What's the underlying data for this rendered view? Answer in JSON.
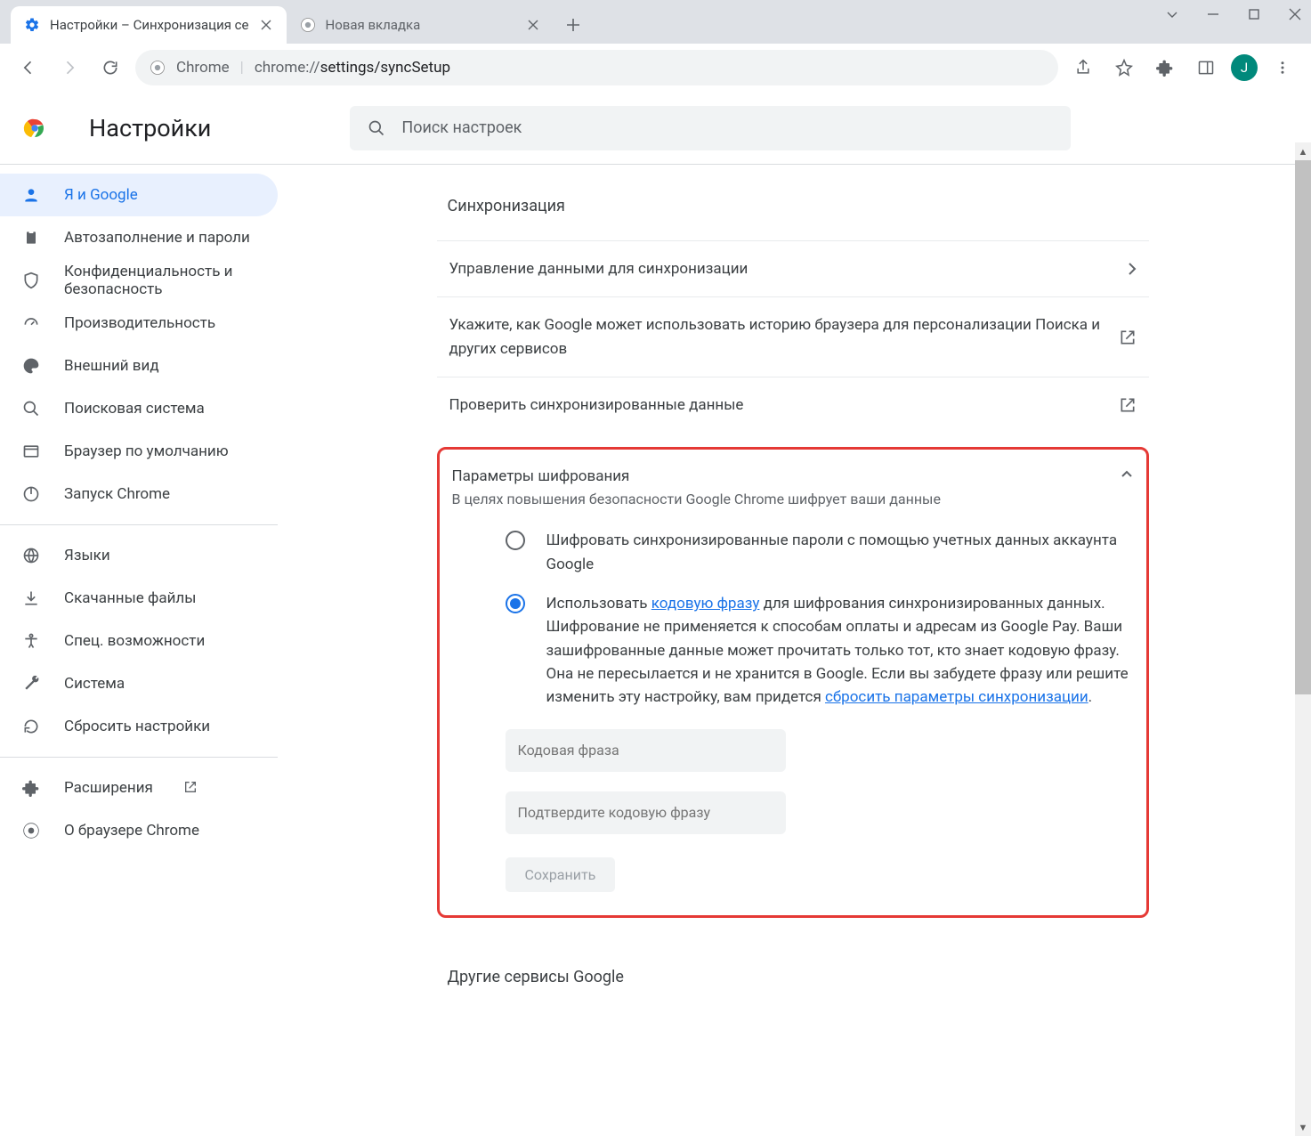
{
  "window": {
    "avatar_initial": "J"
  },
  "tabs": [
    {
      "label": "Настройки – Синхронизация се",
      "active": true
    },
    {
      "label": "Новая вкладка",
      "active": false
    }
  ],
  "omnibox": {
    "scheme_label": "Chrome",
    "url_prefix": "chrome://",
    "url_path": "settings/syncSetup"
  },
  "settings_header": {
    "title": "Настройки",
    "search_placeholder": "Поиск настроек"
  },
  "sidebar": {
    "items": [
      {
        "label": "Я и Google",
        "active": true
      },
      {
        "label": "Автозаполнение и пароли"
      },
      {
        "label": "Конфиденциальность и безопасность"
      },
      {
        "label": "Производительность"
      },
      {
        "label": "Внешний вид"
      },
      {
        "label": "Поисковая система"
      },
      {
        "label": "Браузер по умолчанию"
      },
      {
        "label": "Запуск Chrome"
      }
    ],
    "items2": [
      {
        "label": "Языки"
      },
      {
        "label": "Скачанные файлы"
      },
      {
        "label": "Спец. возможности"
      },
      {
        "label": "Система"
      },
      {
        "label": "Сбросить настройки"
      }
    ],
    "items3": [
      {
        "label": "Расширения"
      },
      {
        "label": "О браузере Chrome"
      }
    ]
  },
  "main": {
    "sync_section_title": "Синхронизация",
    "row_manage": "Управление данными для синхронизации",
    "row_google_usage": "Укажите, как Google может использовать историю браузера для персонализации Поиска и других сервисов",
    "row_check_data": "Проверить синхронизированные данные",
    "enc_title": "Параметры шифрования",
    "enc_subtitle": "В целях повышения безопасности Google Chrome шифрует ваши данные",
    "radio1": "Шифровать синхронизированные пароли с помощью учетных данных аккаунта Google",
    "radio2_pre": "Использовать ",
    "radio2_link1": "кодовую фразу",
    "radio2_mid": " для шифрования синхронизированных данных. Шифрование не применяется к способам оплаты и адресам из Google Pay. Ваши зашифрованные данные может прочитать только тот, кто знает кодовую фразу. Она не пересылается и не хранится в Google. Если вы забудете фразу или решите изменить эту настройку, вам придется ",
    "radio2_link2": "сбросить параметры синхронизации",
    "radio2_post": ".",
    "ph_passphrase": "Кодовая фраза",
    "ph_confirm": "Подтвердите кодовую фразу",
    "save_label": "Сохранить",
    "other_services_title": "Другие сервисы Google"
  }
}
